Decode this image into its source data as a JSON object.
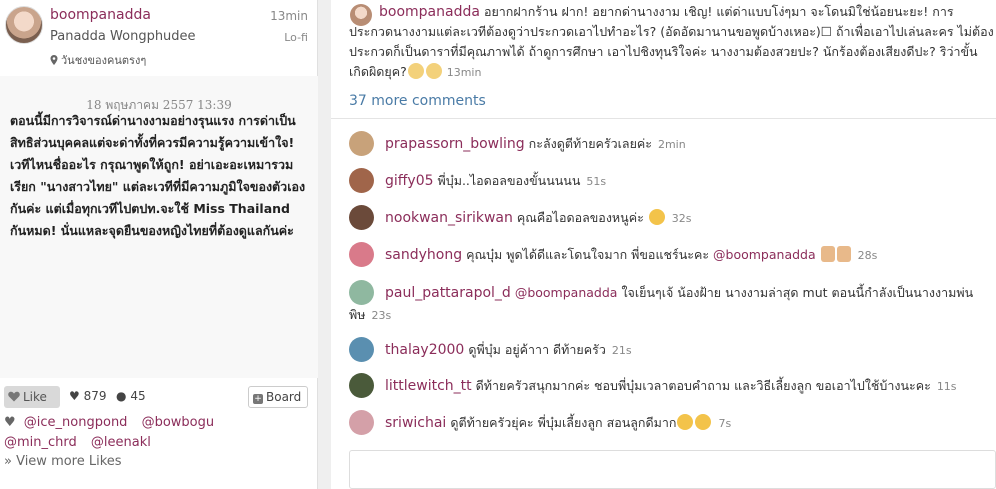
{
  "post": {
    "username": "boompanadda",
    "time_ago": "13min",
    "full_name": "Panadda Wongphudee",
    "filter": "Lo-fi",
    "location": "วันชงของคนตรงๆ",
    "image_date": "18 พฤษภาคม 2557 13:39",
    "image_text": "ตอนนี้มีการวิจารณ์ด่านางงามอย่างรุนแรง การด่าเป็นสิทธิส่วนบุคคลแต่จะด่าทั้งที่ควรมีความรู้ความเข้าใจ! เวทีไหนชื่ออะไร กรุณาพูดให้ถูก! อย่าเอะอะเหมารวมเรียก \"นางสาวไทย\" แต่ละเวทีที่มีความภูมิใจของตัวเองกันค่ะ แต่เมื่อทุกเวทีไปตปท.จะใช้ Miss Thailand กันหมด! นั่นแหละจุดยืนของหญิงไทยที่ต้องดูแลกันค่ะ",
    "like_label": "Like",
    "likes_count": "879",
    "comments_count": "45",
    "board_label": "Board",
    "likers": [
      "@ice_nongpond",
      "@bowbogu",
      "@min_chrd",
      "@leenakl"
    ],
    "view_more_likes": "» View more Likes"
  },
  "caption": {
    "username": "boompanadda",
    "text": "อยากฝากร้าน ฝาก! อยากด่านางงาม เชิญ! แต่ด่าแบบโง่ๆมา จะโดนมิใช่น้อยนะยะ! การประกวดนางงามแต่ละเวทีต้องดูว่าประกวดเอาไปทำอะไร? (อัดอัดมานานขอพูดบ้างเหอะ)☐ ถ้าเพื่อเอาไปเล่นละคร ไม่ต้องประกวดก็เป็นดาราที่มีคุณภาพได้ ถ้าดูการศึกษา เอาไปชิงทุนริใจค่ะ นางงามต้องสวยปะ? นักร้องต้องเสียงดีปะ? ริว่าขั้นเกิดผิดยุค?",
    "time": "13min"
  },
  "more_comments": "37 more comments",
  "comments": [
    {
      "user": "prapassorn_bowling",
      "text": "กะลังดูตีท้ายครัวเลยค่ะ",
      "time": "2min",
      "avatar_color": "#c8a27a"
    },
    {
      "user": "giffy05",
      "text": "พี่บุ๋ม..ไอดอลของขั้นนนนน",
      "time": "51s",
      "avatar_color": "#a0654a"
    },
    {
      "user": "nookwan_sirikwan",
      "text": "คุณคือไอดอลของหนูค่ะ",
      "time": "32s",
      "avatar_color": "#6b4a3a"
    },
    {
      "user": "sandyhong",
      "text": "คุณบุ๋ม พูดได้ดีและโดนใจมาก พี่ขอแชร์นะคะ",
      "mention": "@boompanadda",
      "time": "28s",
      "avatar_color": "#d97a8a"
    },
    {
      "user": "paul_pattarapol_d",
      "text": "ใจเย็นๆเจ้ น้องฝ้าย นางงามล่าสุด mut ตอนนี้กำลังเป็นนางงามพ่นพิษ",
      "mention": "@boompanadda",
      "time": "23s",
      "avatar_color": "#8fb8a0"
    },
    {
      "user": "thalay2000",
      "text": "ดูพี่บุ๋ม อยู่ค้าาา ดีท้ายครัว",
      "time": "21s",
      "avatar_color": "#5a8fb0"
    },
    {
      "user": "littlewitch_tt",
      "text": "ดีท้ายครัวสนุกมากค่ะ ชอบพี่บุ๋มเวลาตอบคำถาม และวิธีเลี้ยงลูก ขอเอาไปใช้บ้างนะคะ",
      "time": "11s",
      "avatar_color": "#4a5a3a"
    },
    {
      "user": "sriwichai",
      "text": "ดูตีท้ายครัวยุ่คะ พี่บุ๋มเลี้ยงลูก สอนลูกดีมาก",
      "time": "7s",
      "avatar_color": "#d4a0a8"
    }
  ]
}
